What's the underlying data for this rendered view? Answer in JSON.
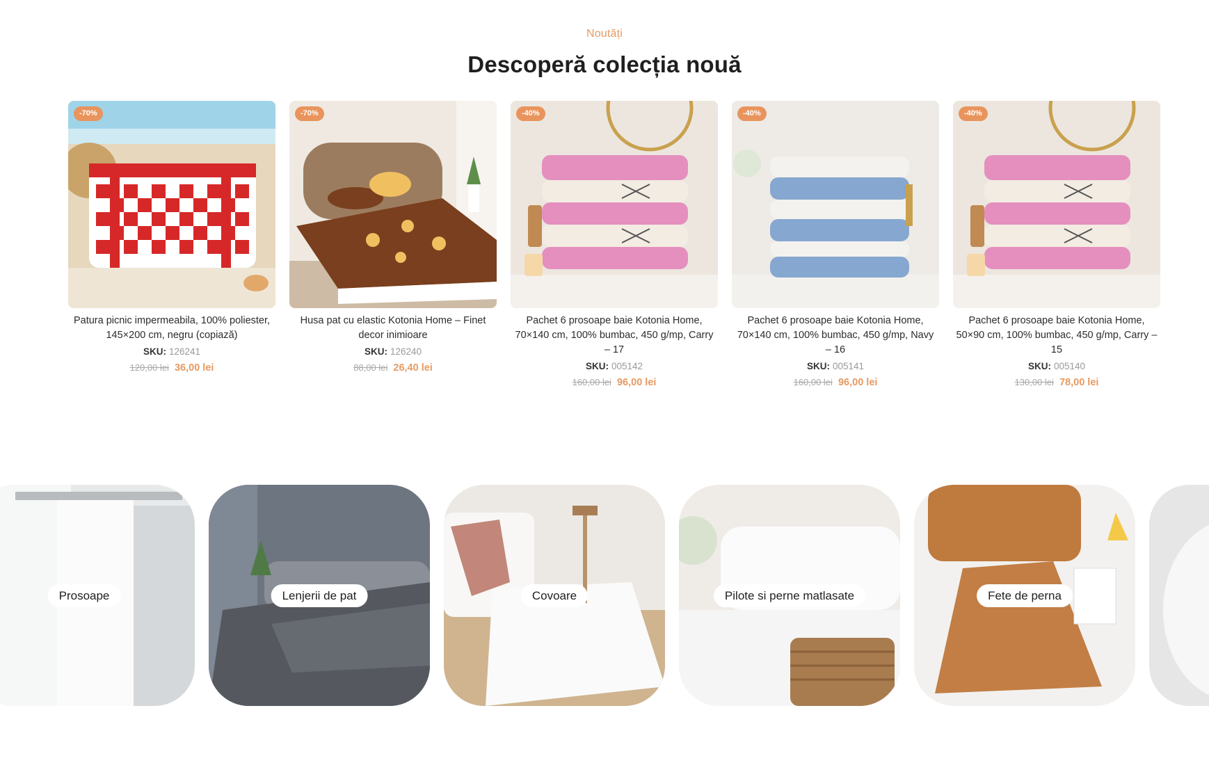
{
  "section": {
    "kicker": "Noutăți",
    "title": "Descoperă colecția nouă"
  },
  "colors": {
    "accent": "#e69a62",
    "badge": "#e8945c"
  },
  "products": [
    {
      "badge": "-70%",
      "title": "Patura picnic impermeabila, 100% poliester, 145×200 cm, negru (copiază)",
      "sku_label": "SKU:",
      "sku": "126241",
      "old_price": "120,00 lei",
      "new_price": "36,00 lei"
    },
    {
      "badge": "-70%",
      "title": "Husa pat cu elastic Kotonia Home – Finet decor inimioare",
      "sku_label": "SKU:",
      "sku": "126240",
      "old_price": "88,00 lei",
      "new_price": "26,40 lei"
    },
    {
      "badge": "-40%",
      "title": "Pachet 6 prosoape baie Kotonia Home, 70×140 cm, 100% bumbac, 450 g/mp, Carry – 17",
      "sku_label": "SKU:",
      "sku": "005142",
      "old_price": "160,00 lei",
      "new_price": "96,00 lei"
    },
    {
      "badge": "-40%",
      "title": "Pachet 6 prosoape baie Kotonia Home, 70×140 cm, 100% bumbac, 450 g/mp, Navy – 16",
      "sku_label": "SKU:",
      "sku": "005141",
      "old_price": "160,00 lei",
      "new_price": "96,00 lei"
    },
    {
      "badge": "-40%",
      "title": "Pachet 6 prosoape baie Kotonia Home, 50×90 cm, 100% bumbac, 450 g/mp, Carry – 15",
      "sku_label": "SKU:",
      "sku": "005140",
      "old_price": "130,00 lei",
      "new_price": "78,00 lei"
    }
  ],
  "categories": [
    {
      "label": "Prosoape"
    },
    {
      "label": "Lenjerii de pat"
    },
    {
      "label": "Covoare"
    },
    {
      "label": "Pilote si perne matlasate"
    },
    {
      "label": "Fete de perna"
    }
  ]
}
